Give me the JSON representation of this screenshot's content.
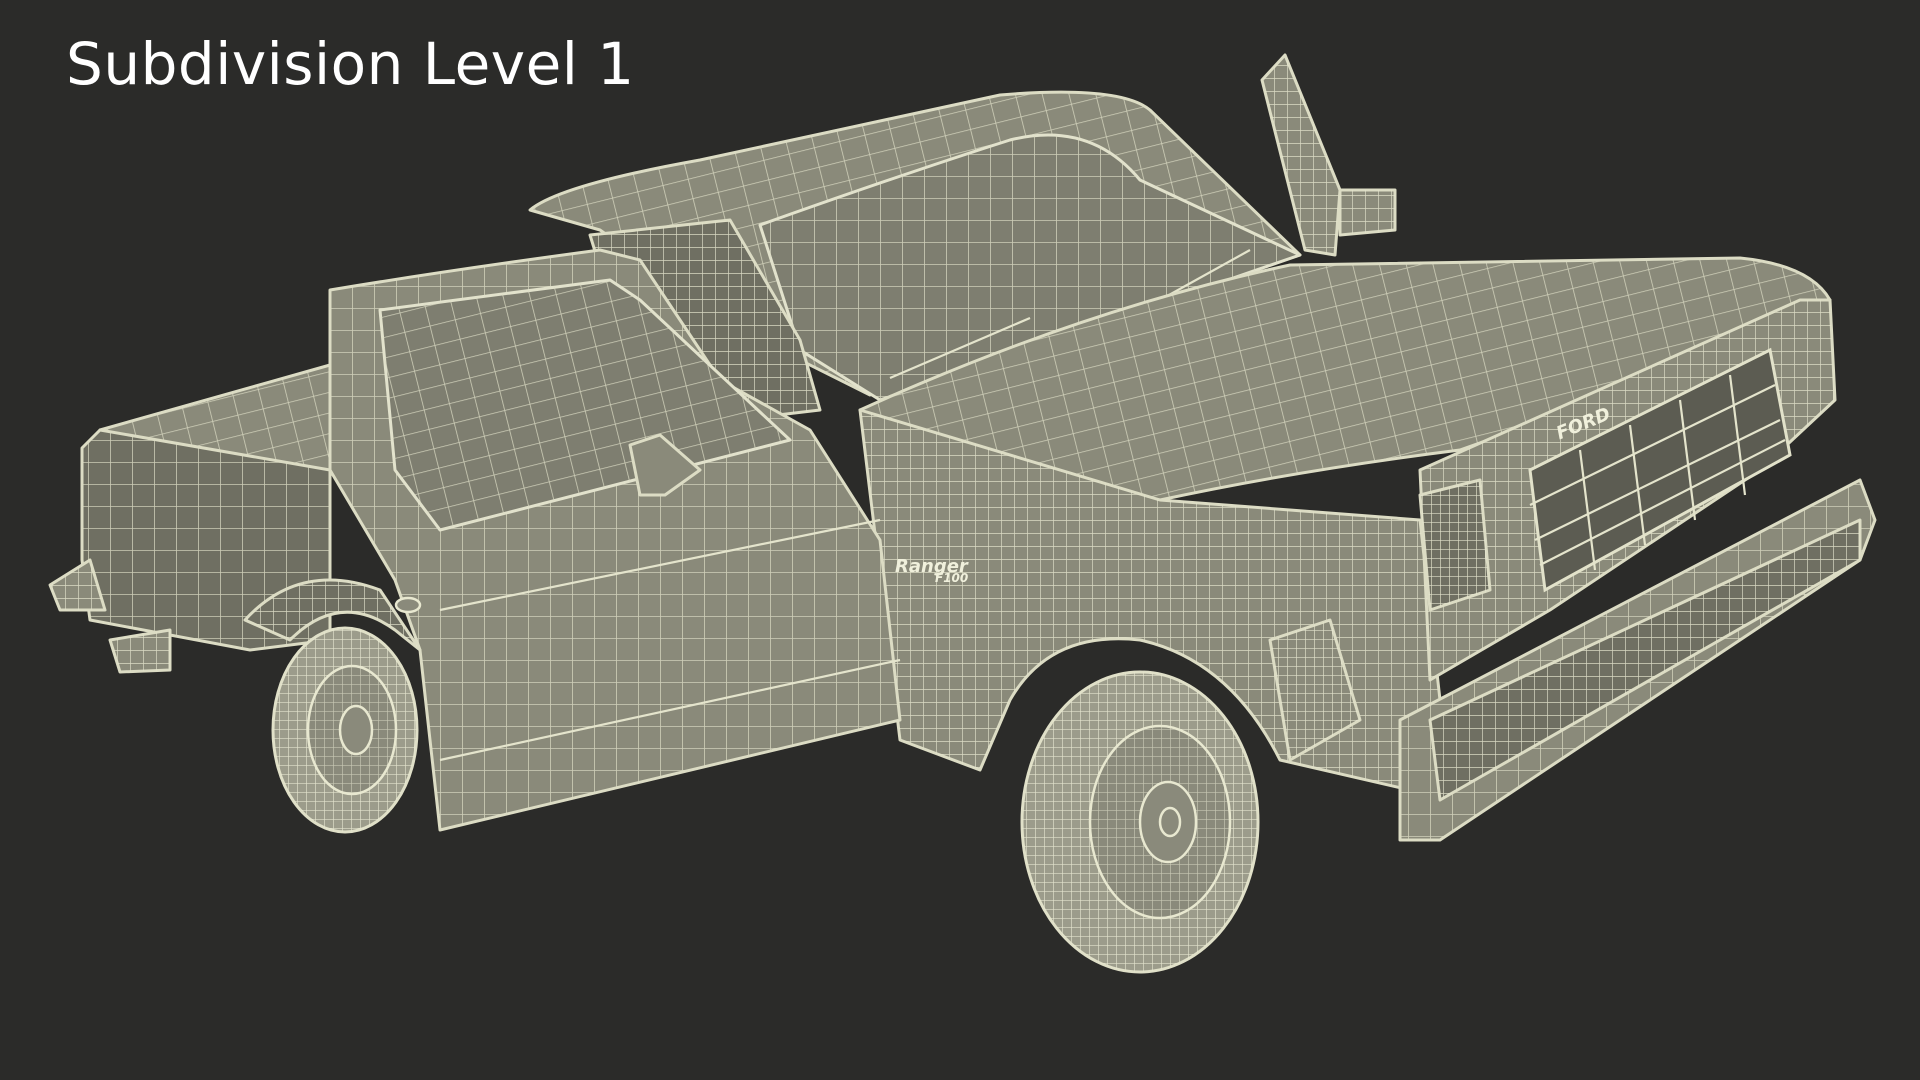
{
  "viewer": {
    "title": "Subdivision Level 1",
    "background_color": "#2b2b29",
    "wireframe_color": "#e0e0c8",
    "model_fill_color": "#8a8a7a"
  },
  "model": {
    "badge_line1": "Ranger",
    "badge_line2": "F100",
    "hood_lettering": "FORD"
  }
}
